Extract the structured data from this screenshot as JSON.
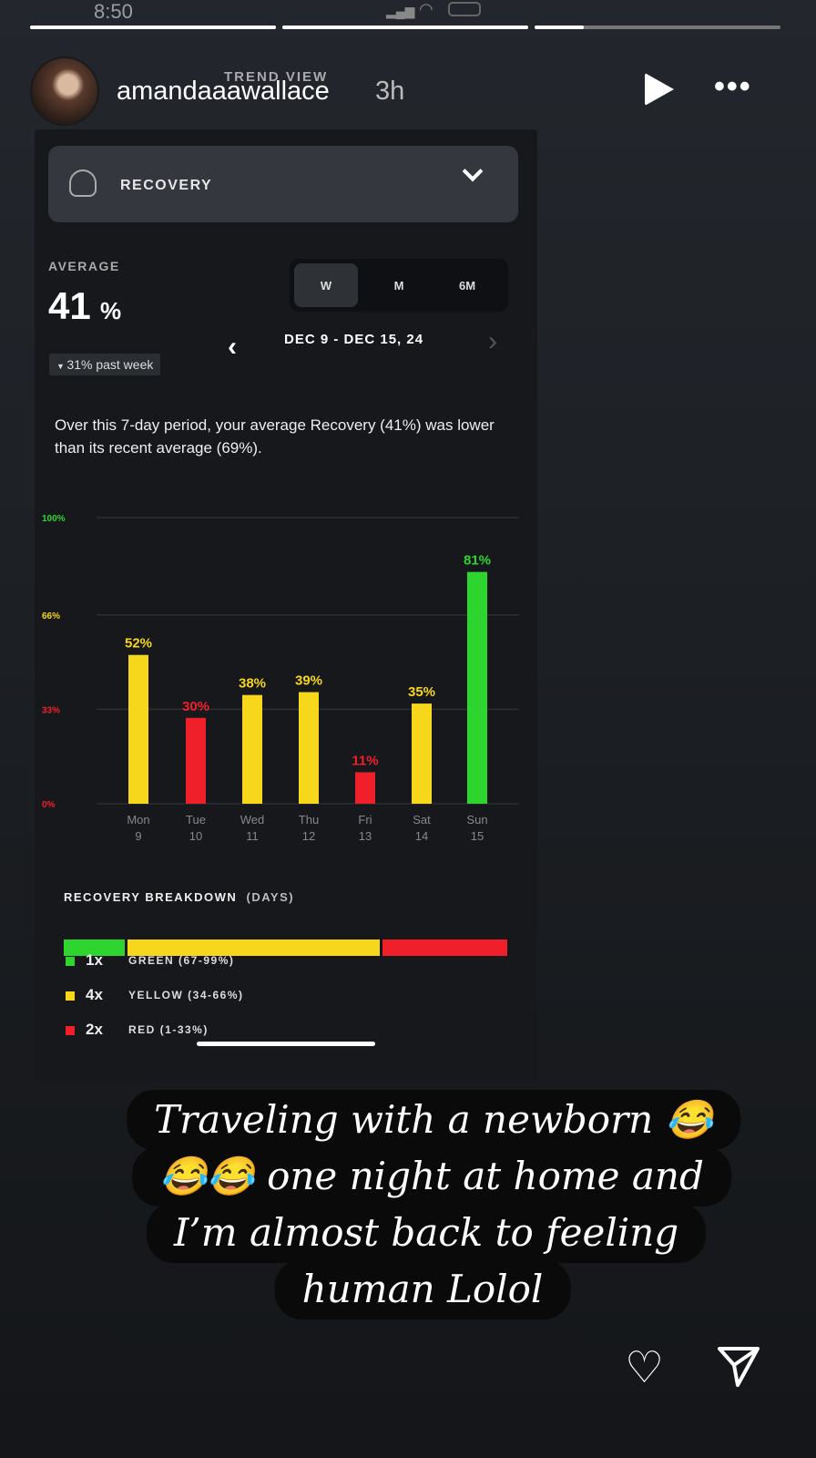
{
  "status_bar": {
    "time": "8:50"
  },
  "story": {
    "username": "amandaaawallace",
    "age": "3h",
    "progress": [
      1.0,
      1.0,
      0.2
    ]
  },
  "app": {
    "header": "TREND VIEW",
    "metric_selector": {
      "label": "RECOVERY",
      "icon": "meditation-icon"
    },
    "average": {
      "label": "AVERAGE",
      "value": "41",
      "unit": "%",
      "change": "31% past week",
      "change_direction": "down"
    },
    "period_tabs": [
      {
        "label": "W",
        "selected": true
      },
      {
        "label": "M",
        "selected": false
      },
      {
        "label": "6M",
        "selected": false
      }
    ],
    "date_range": "DEC 9 - DEC 15, 24",
    "summary": "Over this 7-day period, your average Recovery (41%) was lower than its recent average (69%).",
    "breakdown": {
      "title": "RECOVERY BREAKDOWN",
      "unit": "(DAYS)",
      "items": [
        {
          "count": "1x",
          "label": "GREEN (67-99%)",
          "color": "#2fd52f",
          "days": 1
        },
        {
          "count": "4x",
          "label": "YELLOW (34-66%)",
          "color": "#f6d71c",
          "days": 4
        },
        {
          "count": "2x",
          "label": "RED (1-33%)",
          "color": "#f0202a",
          "days": 2
        }
      ]
    }
  },
  "chart_data": {
    "type": "bar",
    "categories": [
      "Mon 9",
      "Tue 10",
      "Wed 11",
      "Thu 12",
      "Fri 13",
      "Sat 14",
      "Sun 15"
    ],
    "days": [
      "Mon",
      "Tue",
      "Wed",
      "Thu",
      "Fri",
      "Sat",
      "Sun"
    ],
    "dates": [
      "9",
      "10",
      "11",
      "12",
      "13",
      "14",
      "15"
    ],
    "values": [
      52,
      30,
      38,
      39,
      11,
      35,
      81
    ],
    "labels": [
      "52%",
      "30%",
      "38%",
      "39%",
      "11%",
      "35%",
      "81%"
    ],
    "colors": [
      "#f6d71c",
      "#f0202a",
      "#f6d71c",
      "#f6d71c",
      "#f0202a",
      "#f6d71c",
      "#2fd52f"
    ],
    "yticks": [
      {
        "value": 0,
        "label": "0%",
        "color": "#f0202a"
      },
      {
        "value": 33,
        "label": "33%",
        "color": "#f0202a"
      },
      {
        "value": 66,
        "label": "66%",
        "color": "#f6d71c"
      },
      {
        "value": 100,
        "label": "100%",
        "color": "#2fd52f"
      }
    ],
    "ylim": [
      0,
      100
    ],
    "grid": true
  },
  "caption": {
    "lines": [
      "Traveling with a newborn 😂",
      "😂😂 one night at home and",
      "I’m almost back to feeling",
      "human Lolol"
    ]
  }
}
